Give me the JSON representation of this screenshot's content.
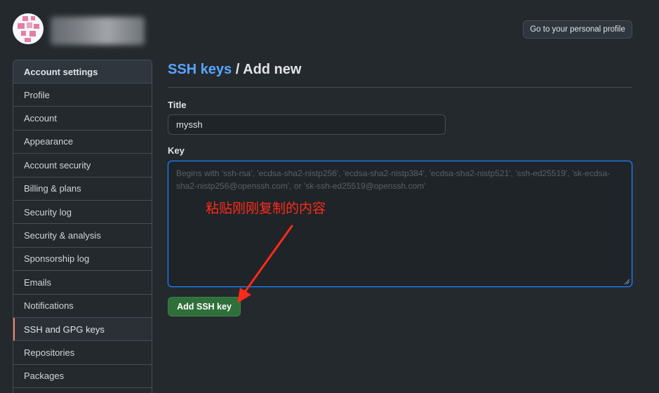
{
  "header": {
    "profile_button": "Go to your personal profile"
  },
  "sidebar": {
    "heading": "Account settings",
    "items": [
      {
        "label": "Profile"
      },
      {
        "label": "Account"
      },
      {
        "label": "Appearance"
      },
      {
        "label": "Account security"
      },
      {
        "label": "Billing & plans"
      },
      {
        "label": "Security log"
      },
      {
        "label": "Security & analysis"
      },
      {
        "label": "Sponsorship log"
      },
      {
        "label": "Emails"
      },
      {
        "label": "Notifications"
      },
      {
        "label": "SSH and GPG keys",
        "selected": true
      },
      {
        "label": "Repositories"
      },
      {
        "label": "Packages"
      }
    ]
  },
  "main": {
    "breadcrumb_link": "SSH keys",
    "breadcrumb_separator": "/",
    "breadcrumb_current": "Add new",
    "title_label": "Title",
    "title_value": "myssh",
    "key_label": "Key",
    "key_placeholder": "Begins with 'ssh-rsa', 'ecdsa-sha2-nistp256', 'ecdsa-sha2-nistp384', 'ecdsa-sha2-nistp521', 'ssh-ed25519', 'sk-ecdsa-sha2-nistp256@openssh.com', or 'sk-ssh-ed25519@openssh.com'",
    "submit_label": "Add SSH key"
  },
  "annotation": {
    "text": "粘贴刚刚复制的内容",
    "color": "#ff2a1a"
  },
  "colors": {
    "background": "#24292e",
    "link": "#58a6ff",
    "accent_selected": "#f9826c",
    "primary_button": "#2f6f3a"
  }
}
